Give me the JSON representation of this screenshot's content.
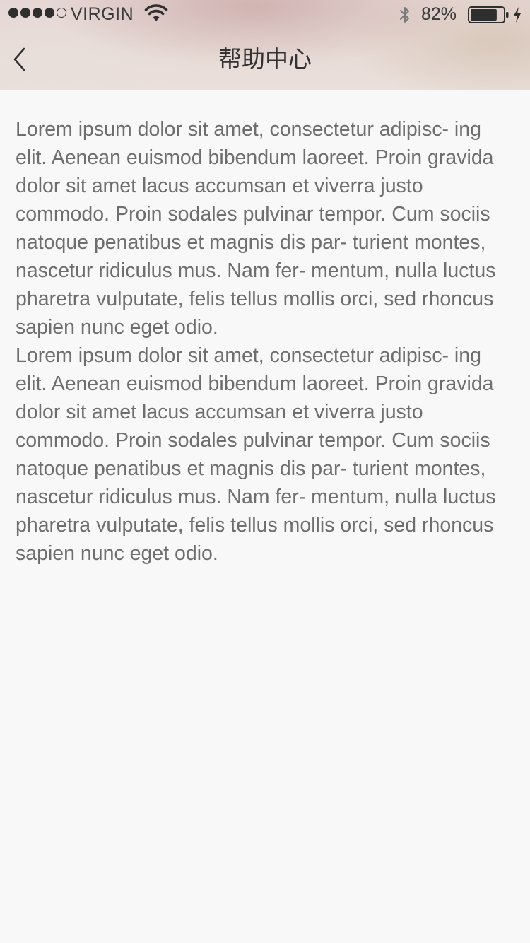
{
  "status_bar": {
    "carrier": "VIRGIN",
    "signal_bars_filled": 4,
    "signal_bars_total": 5,
    "battery_percent": "82%",
    "battery_level": 0.82,
    "icons": [
      "signal-dots",
      "wifi-icon",
      "bluetooth-icon",
      "battery-icon",
      "charging-bolt-icon"
    ]
  },
  "nav": {
    "back_icon": "chevron-left-icon",
    "title": "帮助中心"
  },
  "content": {
    "paragraphs": [
      "Lorem ipsum dolor sit amet, consectetur adipisc- ing elit. Aenean euismod bibendum laoreet. Proin gravida dolor sit amet lacus accumsan et viverra justo commodo. Proin sodales pulvinar tempor. Cum sociis natoque penatibus et magnis dis par- turient montes, nascetur ridiculus mus. Nam fer- mentum, nulla luctus pharetra vulputate, felis tellus mollis orci, sed rhoncus sapien nunc eget odio.",
      "Lorem ipsum dolor sit amet, consectetur adipisc- ing elit. Aenean euismod bibendum laoreet. Proin gravida dolor sit amet lacus accumsan et viverra justo commodo. Proin sodales pulvinar tempor. Cum sociis natoque penatibus et magnis dis par- turient montes, nascetur ridiculus mus. Nam fer- mentum, nulla luctus pharetra vulputate, felis tellus mollis orci, sed rhoncus sapien nunc eget odio."
    ]
  },
  "colors": {
    "background": "#f8f8f8",
    "title_text": "#333333",
    "body_text": "#6e6e6e"
  }
}
